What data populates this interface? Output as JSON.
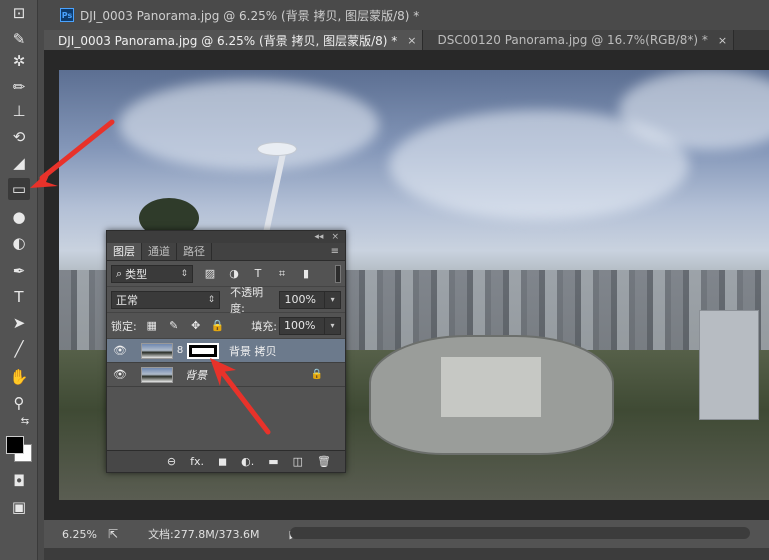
{
  "window": {
    "title": "DJI_0003 Panorama.jpg @ 6.25% (背景 拷贝, 图层蒙版/8) *",
    "app_badge": "Ps"
  },
  "tabs": [
    {
      "label": "DJI_0003 Panorama.jpg @ 6.25% (背景 拷贝, 图层蒙版/8) *",
      "close": "×",
      "active": true
    },
    {
      "label": "DSC00120 Panorama.jpg @ 16.7%(RGB/8*) *",
      "close": "×",
      "active": false
    }
  ],
  "tools": [
    {
      "name": "crop-icon",
      "glyph": "⊡"
    },
    {
      "name": "eyedropper-icon",
      "glyph": "✎"
    },
    {
      "name": "healing-brush-icon",
      "glyph": "✲"
    },
    {
      "name": "brush-icon",
      "glyph": "✏"
    },
    {
      "name": "clone-stamp-icon",
      "glyph": "⊥"
    },
    {
      "name": "history-brush-icon",
      "glyph": "⟲"
    },
    {
      "name": "eraser-icon",
      "glyph": "◢"
    },
    {
      "name": "gradient-icon",
      "glyph": "▭"
    },
    {
      "name": "blur-icon",
      "glyph": "●"
    },
    {
      "name": "dodge-icon",
      "glyph": "◐"
    },
    {
      "name": "pen-icon",
      "glyph": "✒"
    },
    {
      "name": "type-icon",
      "glyph": "T"
    },
    {
      "name": "path-selection-icon",
      "glyph": "➤"
    },
    {
      "name": "line-icon",
      "glyph": "╱"
    },
    {
      "name": "hand-icon",
      "glyph": "✋"
    },
    {
      "name": "zoom-icon",
      "glyph": "⚲"
    },
    {
      "name": "swap-colors-icon",
      "glyph": "⇆"
    },
    {
      "name": "quick-mask-icon",
      "glyph": "◘"
    },
    {
      "name": "screen-mode-icon",
      "glyph": "▣"
    }
  ],
  "layers_panel": {
    "top_controls": {
      "collapse": "◂◂",
      "close": "×"
    },
    "tabs": [
      "图层",
      "通道",
      "路径"
    ],
    "menu_icon": "≡",
    "filter": {
      "label": "类型",
      "search_glyph": "⌕",
      "caret": "⇕"
    },
    "filter_icons": [
      "▨",
      "◑",
      "T",
      "⌗",
      "▮"
    ],
    "blend_mode": "正常",
    "opacity_label": "不透明度:",
    "opacity_value": "100%",
    "lock_label": "锁定:",
    "lock_icons": [
      "▦",
      "✎",
      "✥",
      "🔒"
    ],
    "fill_label": "填充:",
    "fill_value": "100%",
    "layers": [
      {
        "name": "背景 拷贝",
        "visible_glyph": "👁",
        "selected": true,
        "has_mask": true,
        "chain_glyph": "8"
      },
      {
        "name": "背景",
        "visible_glyph": "👁",
        "selected": false,
        "locked": true,
        "lock_glyph": "🔒"
      }
    ],
    "bottom_icons": [
      "⊖",
      "fx.",
      "◼",
      "◐.",
      "▬",
      "◫",
      "🗑"
    ]
  },
  "status": {
    "zoom": "6.25%",
    "doc_info": "文档:277.8M/373.6M",
    "export_glyph": "⇱",
    "arrow_glyph": "▶"
  },
  "colors": {
    "accent_arrow": "#e8322a",
    "selected_layer": "#6c7a8c",
    "foreground": "#000000",
    "background": "#ffffff"
  }
}
